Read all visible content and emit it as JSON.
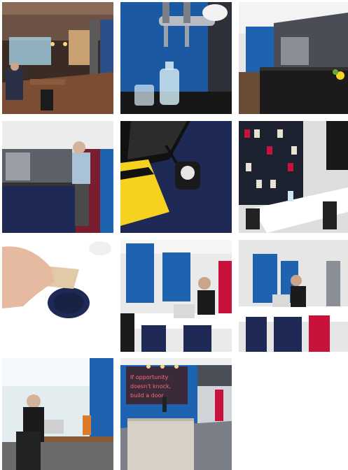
{
  "gallery": {
    "photos": [
      {
        "id": "photo-restaurant-interior"
      },
      {
        "id": "photo-beer-tap-carafe"
      },
      {
        "id": "photo-kitchen-counter"
      },
      {
        "id": "photo-coffee-station-man"
      },
      {
        "id": "photo-laptop-presentation-button"
      },
      {
        "id": "photo-meeting-room-shelves"
      },
      {
        "id": "photo-hand-phone-wireless-charger"
      },
      {
        "id": "photo-woman-laptop-blue-wall"
      },
      {
        "id": "photo-woman-laptop-wide"
      },
      {
        "id": "photo-woman-laptop-window"
      },
      {
        "id": "photo-neon-sign-reception"
      }
    ],
    "neon_sign": {
      "line1": "If opportunity",
      "line2": "doesn't knock,",
      "line3": "build a door"
    },
    "colors": {
      "brand_blue": "#1d63b0",
      "brand_red": "#c8123c",
      "brand_yellow": "#f4d21f",
      "navy": "#1e2a55"
    }
  }
}
